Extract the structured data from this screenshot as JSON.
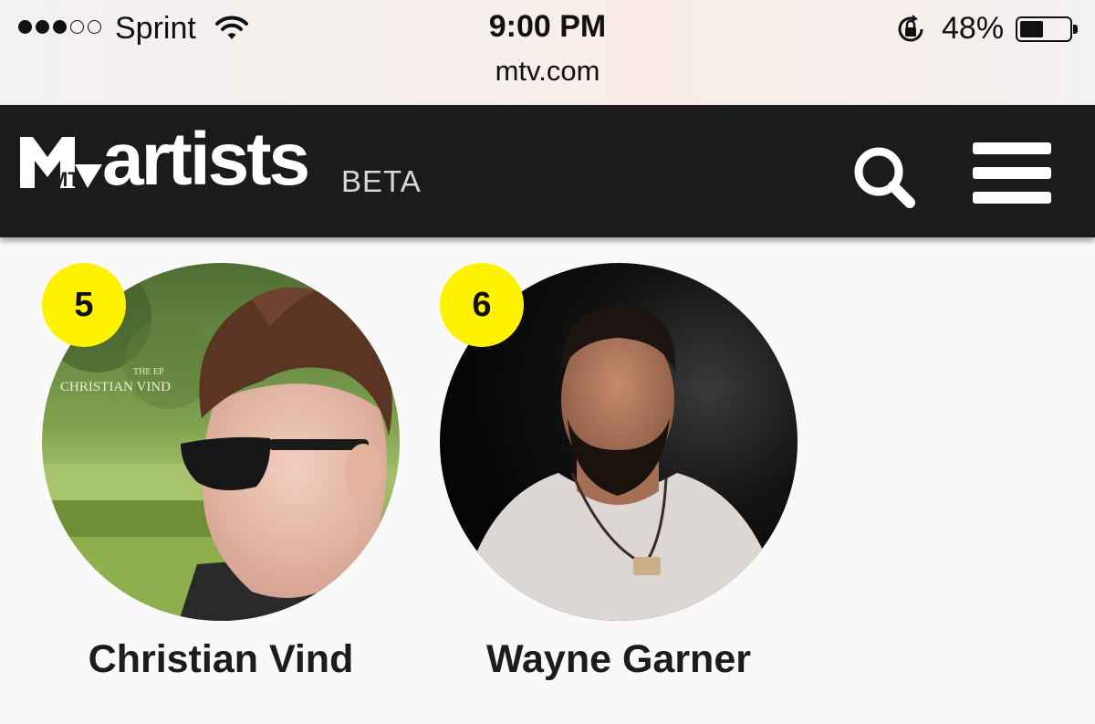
{
  "status_bar": {
    "carrier": "Sprint",
    "time": "9:00 PM",
    "url": "mtv.com",
    "battery": "48%",
    "battery_level": 0.48,
    "signal_bars_filled": 3,
    "signal_bars_total": 5
  },
  "header": {
    "logo_mark": "MTV",
    "brand": "artists",
    "badge": "BETA",
    "icons": [
      "search-icon",
      "menu-icon"
    ]
  },
  "artists": [
    {
      "rank": "5",
      "name": "Christian Vind",
      "cover_text_small": "THE EP",
      "cover_text": "CHRISTIAN VIND"
    },
    {
      "rank": "6",
      "name": "Wayne Garner"
    }
  ],
  "colors": {
    "header_bg": "#1b1b1b",
    "rank_badge": "#fff200",
    "page_bg": "#f9f9f9"
  }
}
